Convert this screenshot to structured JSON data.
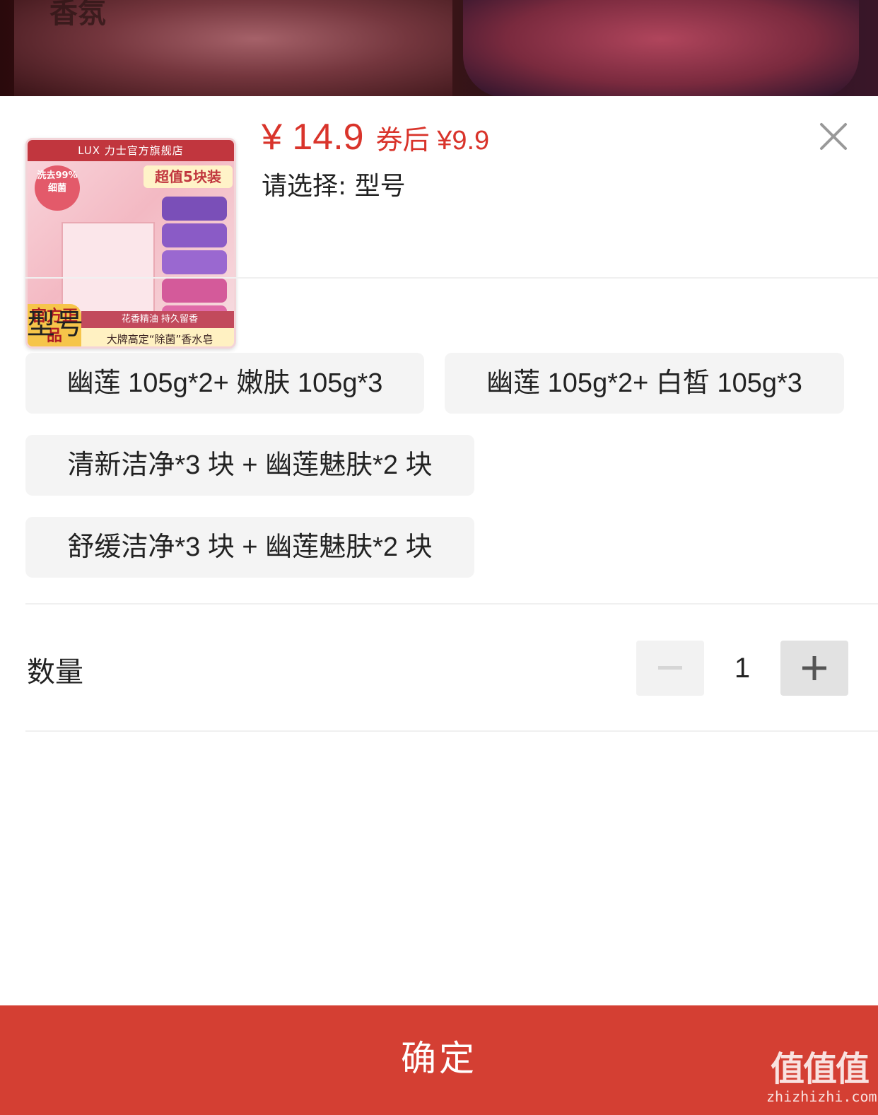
{
  "backdrop": {
    "partial_text": "香氛"
  },
  "product": {
    "image": {
      "store": "LUX 力士官方旗舰店",
      "badge_left": "洗去99%细菌",
      "badge_right": "超值5块装",
      "official": "官方正品",
      "slogan_mid": "花香精油 持久留香",
      "slogan_bottom": "大牌高定“除菌”香水皂"
    },
    "price": "¥ 14.9",
    "price_after_coupon": "券后 ¥9.9",
    "select_hint": "请选择: 型号"
  },
  "colors": {
    "accent": "#d9342b",
    "confirm_bg": "#d43f33",
    "chip_bg": "#f4f4f4"
  },
  "icons": {
    "close": "close-icon",
    "minus": "minus-icon",
    "plus": "plus-icon"
  },
  "variant_section": {
    "title": "型号",
    "options": [
      "幽莲 105g*2+ 嫩肤 105g*3",
      "幽莲 105g*2+ 白皙 105g*3",
      "清新洁净*3 块 + 幽莲魅肤*2 块",
      "舒缓洁净*3 块 + 幽莲魅肤*2 块"
    ]
  },
  "quantity": {
    "label": "数量",
    "value": "1"
  },
  "confirm_button": "确定",
  "watermark": {
    "logo": "值值值",
    "url": "zhizhizhi.com"
  }
}
